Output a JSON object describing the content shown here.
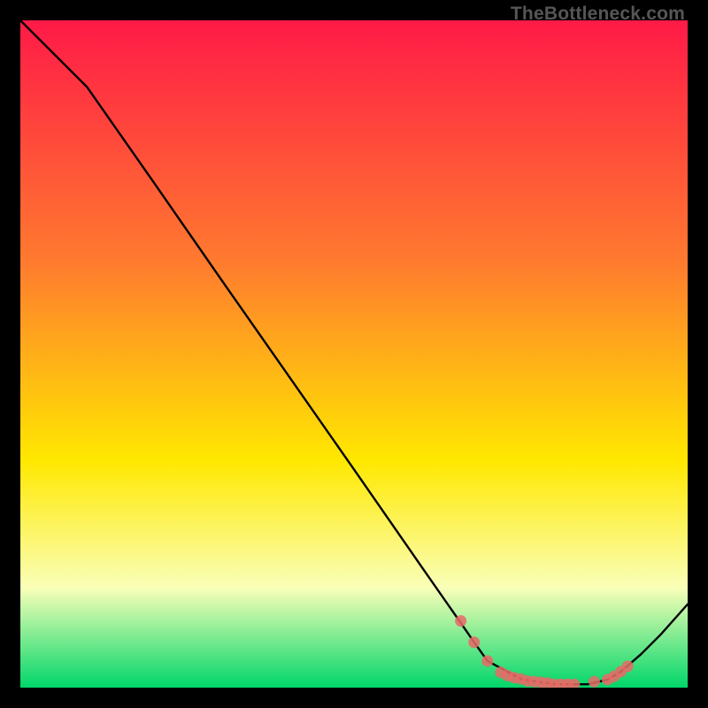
{
  "attribution": "TheBottleneck.com",
  "colors": {
    "gradient_top": "#ff1a47",
    "gradient_mid1": "#ff7a2f",
    "gradient_mid2": "#ffe800",
    "gradient_mid3": "#faffb8",
    "gradient_bottom": "#00d66a",
    "curve": "#000000",
    "dot": "#e86a66",
    "background": "#000000"
  },
  "chart_data": {
    "type": "line",
    "title": "",
    "xlabel": "",
    "ylabel": "",
    "xlim": [
      0,
      100
    ],
    "ylim": [
      0,
      100
    ],
    "curve": {
      "x": [
        0,
        6,
        10,
        20,
        30,
        40,
        50,
        60,
        66,
        68,
        70,
        75,
        80,
        83,
        85,
        88,
        90,
        93,
        96,
        100
      ],
      "y": [
        100,
        94,
        90,
        75.7,
        61.3,
        47,
        32.7,
        18.3,
        9.7,
        6.8,
        4,
        1.3,
        0.5,
        0.5,
        0.5,
        1.2,
        2.4,
        5,
        8,
        12.5
      ]
    },
    "dots": {
      "x": [
        66,
        68,
        70,
        72,
        73,
        74,
        75,
        76,
        77,
        78,
        79,
        80,
        81,
        82,
        83,
        86,
        88,
        89,
        90,
        91
      ],
      "y": [
        10,
        6.8,
        4,
        2.3,
        1.8,
        1.5,
        1.3,
        1.0,
        0.9,
        0.8,
        0.7,
        0.5,
        0.5,
        0.5,
        0.5,
        0.9,
        1.2,
        1.7,
        2.4,
        3.2
      ]
    }
  }
}
